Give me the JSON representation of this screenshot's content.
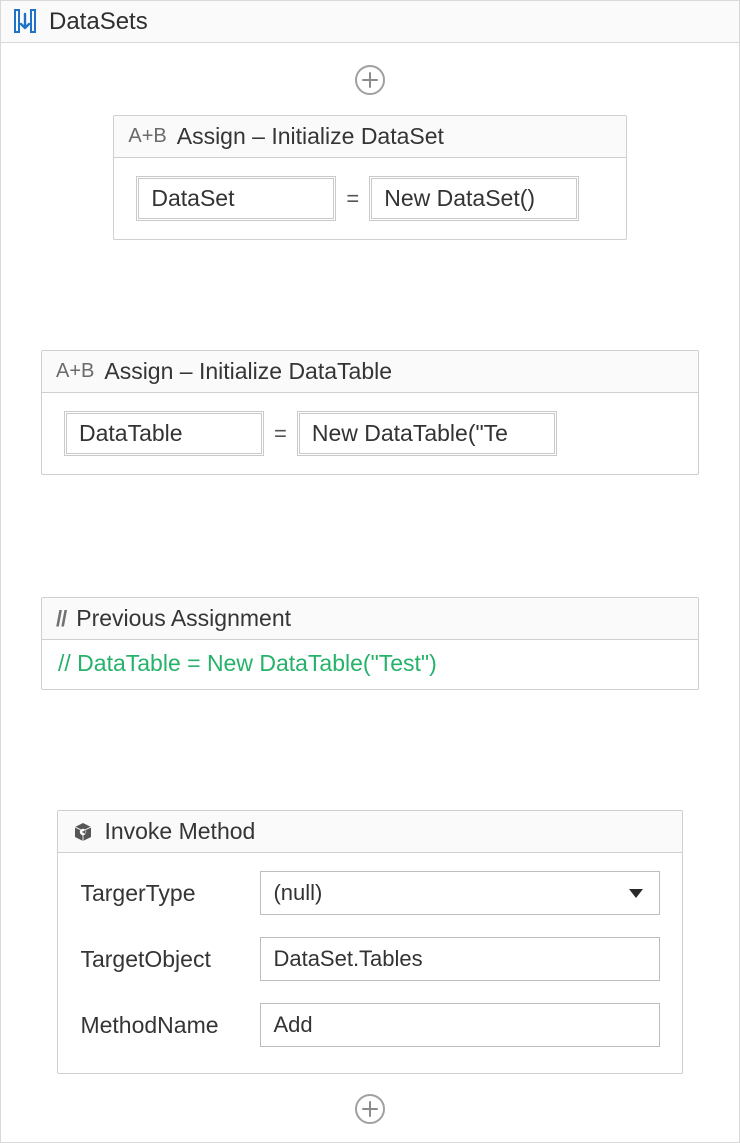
{
  "title": "DataSets",
  "activities": {
    "assign1": {
      "prefix": "A+B",
      "title": "Assign – Initialize DataSet",
      "lhs": "DataSet",
      "eq": "=",
      "rhs": "New DataSet()"
    },
    "assign2": {
      "prefix": "A+B",
      "title": "Assign – Initialize DataTable",
      "lhs": "DataTable",
      "eq": "=",
      "rhs": "New DataTable(\"Te"
    },
    "comment": {
      "prefix": "//",
      "title": "Previous Assignment",
      "body": "// DataTable = New DataTable(\"Test\")"
    },
    "invoke": {
      "title": "Invoke Method",
      "props": {
        "targetTypeLabel": "TargerType",
        "targetTypeValue": "(null)",
        "targetObjectLabel": "TargetObject",
        "targetObjectValue": "DataSet.Tables",
        "methodNameLabel": "MethodName",
        "methodNameValue": "Add"
      }
    }
  }
}
